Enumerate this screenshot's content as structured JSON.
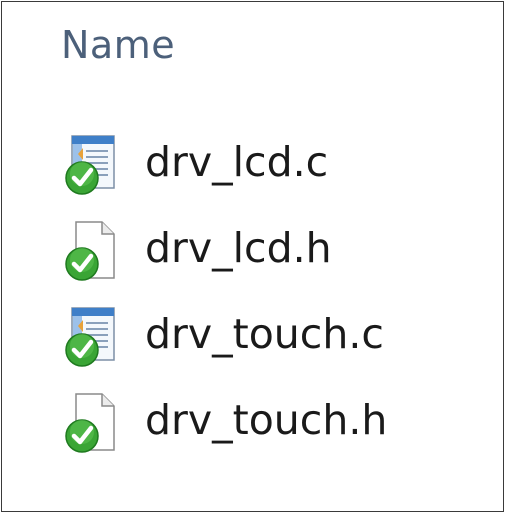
{
  "explorer": {
    "column_header": "Name",
    "files": [
      {
        "name": "drv_lcd.c",
        "icon": "c-source-file-icon",
        "status": "synced-check-icon"
      },
      {
        "name": "drv_lcd.h",
        "icon": "header-file-icon",
        "status": "synced-check-icon"
      },
      {
        "name": "drv_touch.c",
        "icon": "c-source-file-icon",
        "status": "synced-check-icon"
      },
      {
        "name": "drv_touch.h",
        "icon": "header-file-icon",
        "status": "synced-check-icon"
      }
    ]
  },
  "colors": {
    "header_text": "#4c607a",
    "file_text": "#1a1a1a",
    "check_green": "#3aa535",
    "border": "#3a3a3a"
  }
}
